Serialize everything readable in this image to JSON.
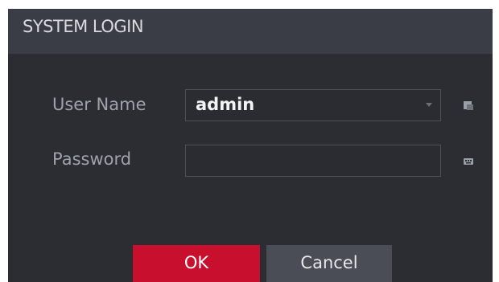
{
  "dialog": {
    "title": "SYSTEM LOGIN"
  },
  "form": {
    "username": {
      "label": "User Name",
      "value": "admin",
      "control": "dropdown",
      "icon": "user-select-icon"
    },
    "password": {
      "label": "Password",
      "value": "",
      "icon": "keyboard-icon"
    }
  },
  "buttons": {
    "ok_label": "OK",
    "cancel_label": "Cancel"
  },
  "colors": {
    "ok_button": "#c8102e",
    "cancel_button": "#4a4d55",
    "dialog_bg": "#2b2d32",
    "title_bar": "#3a3d45"
  }
}
